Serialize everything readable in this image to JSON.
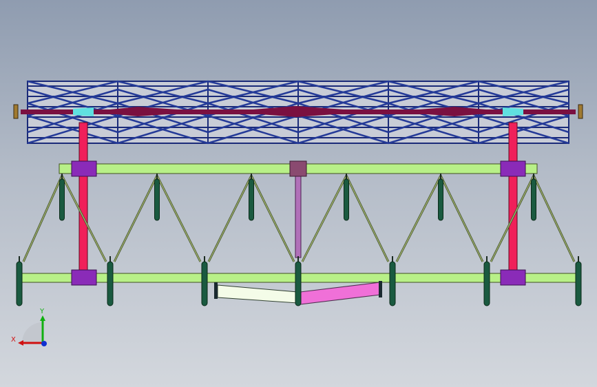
{
  "triad": {
    "x_label": "X",
    "y_label": "Y",
    "x_color": "#d01010",
    "y_color": "#10b010",
    "z_color": "#1030d0"
  },
  "colors": {
    "roller_cage": "#1a2a78",
    "roller_shaft": "#7a1040",
    "roller_end": "#60e0e0",
    "frame_beam": "#b8f088",
    "beam_outline": "#405020",
    "crimson_post": "#f0205a",
    "center_post": "#b070b8",
    "mount_block": "#8a2bb8",
    "center_block": "#8a4a70",
    "tine": "#1a5a40",
    "spring_arm": "#a0b070",
    "left_link": "#f4fce8",
    "right_link": "#f070d8"
  }
}
